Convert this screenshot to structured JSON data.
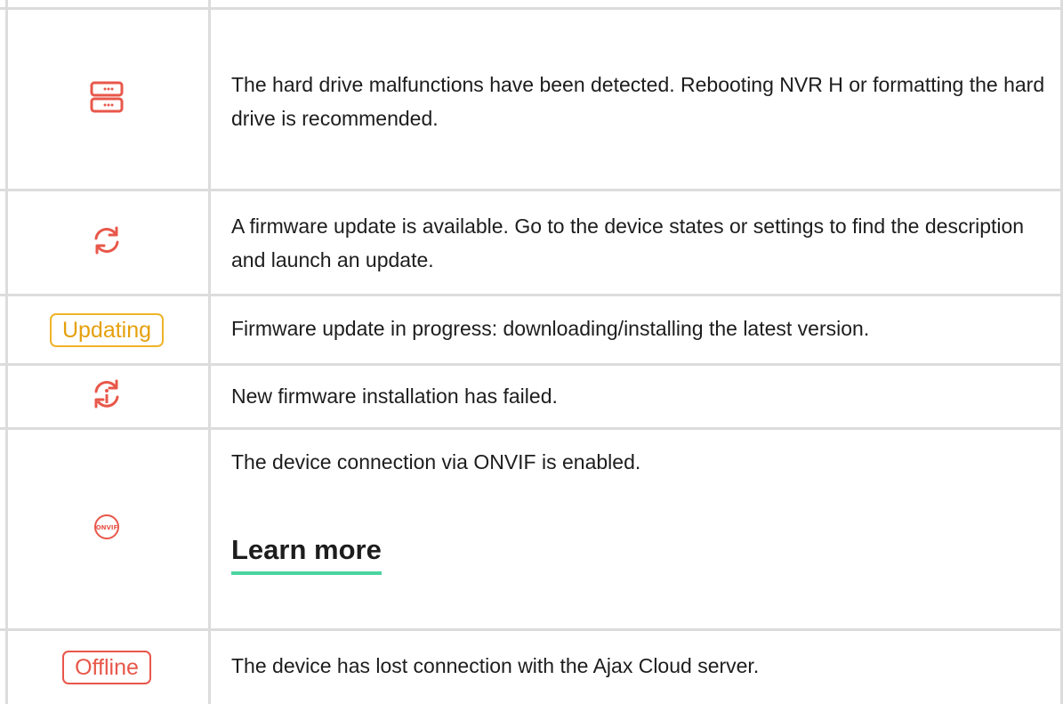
{
  "colors": {
    "accent_red": "#e8574a",
    "accent_yellow": "#f0b429",
    "link_underline": "#4cd4a0",
    "grid": "#dcdcdc"
  },
  "rows": [
    {
      "icon": "hard-drive-icon",
      "text": "The hard drive malfunctions have been detected. Rebooting NVR H or formatting the hard drive is recommended."
    },
    {
      "icon": "refresh-icon",
      "text": "A firmware update is available. Go to the device states or settings to find the description and launch an update."
    },
    {
      "badge": "Updating",
      "text": "Firmware update in progress: downloading/installing the latest version."
    },
    {
      "icon": "update-failed-icon",
      "text": "New firmware installation has failed."
    },
    {
      "icon": "onvif-icon",
      "icon_text": "ONVIF",
      "text": "The device connection via ONVIF is enabled.",
      "link": "Learn more"
    },
    {
      "badge": "Offline",
      "text": "The device has lost connection with the Ajax Cloud server."
    }
  ]
}
